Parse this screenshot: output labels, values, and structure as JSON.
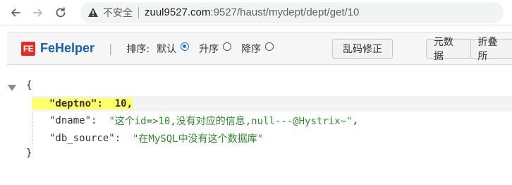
{
  "browser": {
    "security_text": "不安全",
    "url_host": "zuul9527.com",
    "url_path": ":9527/haust/mydept/dept/get/10",
    "icons": {
      "back": "back-arrow-icon",
      "forward": "forward-arrow-icon",
      "reload": "reload-icon",
      "warning": "warning-icon"
    }
  },
  "fehelper": {
    "logo_badge": "FE",
    "name": "FeHelper",
    "divider": "|",
    "sort_label": "排序:",
    "sort_options": [
      {
        "label": "默认",
        "checked": true
      },
      {
        "label": "升序",
        "checked": false
      },
      {
        "label": "降序",
        "checked": false
      }
    ],
    "encoding_button": "乱码修正",
    "raw_button": "元数据",
    "fold_button": "折叠所"
  },
  "json": {
    "open_brace": "{",
    "close_brace": "}",
    "lines": [
      {
        "key": "\"deptno\"",
        "colon": ":",
        "value": "10",
        "comma": ",",
        "value_type": "number",
        "highlighted": true
      },
      {
        "key": "\"dname\"",
        "colon": ":",
        "value": "\"这个id=>10,没有对应的信息,null---@Hystrix~\"",
        "comma": ",",
        "value_type": "string",
        "highlighted": false
      },
      {
        "key": "\"db_source\"",
        "colon": ":",
        "value": "\"在MySQL中没有这个数据库\"",
        "comma": "",
        "value_type": "string",
        "highlighted": false
      }
    ]
  },
  "colors": {
    "logo_red": "#e22b2b",
    "logo_blue": "#1a5fb4",
    "highlight_yellow": "#ffff66",
    "string_green": "#2e8b2e",
    "radio_blue": "#1a73e8"
  }
}
